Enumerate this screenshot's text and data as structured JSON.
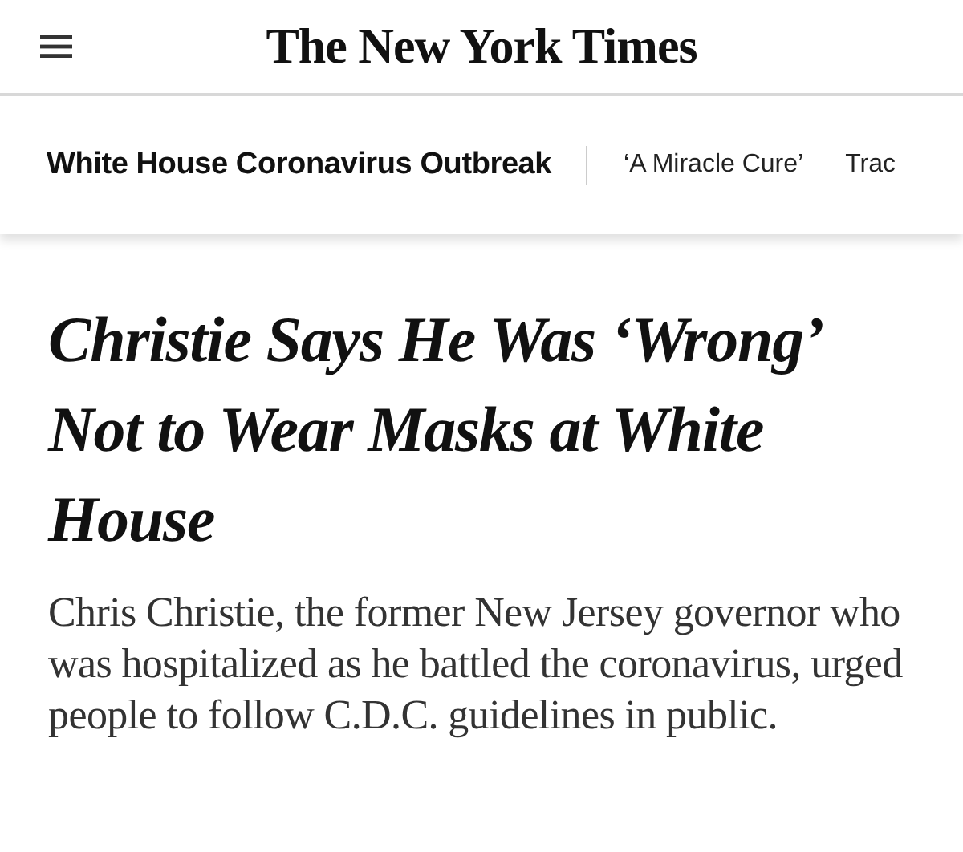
{
  "masthead": {
    "logo": "The New York Times"
  },
  "section_nav": {
    "title": "White House Coronavirus Outbreak",
    "links": [
      "‘A Miracle Cure’",
      "Trac"
    ]
  },
  "article": {
    "headline": "Christie Says He Was ‘Wrong’ Not to Wear Masks at White House",
    "summary": "Chris Christie, the former New Jersey governor who was hospitalized as he battled the coronavirus, urged people to follow C.D.C. guidelines in public."
  }
}
